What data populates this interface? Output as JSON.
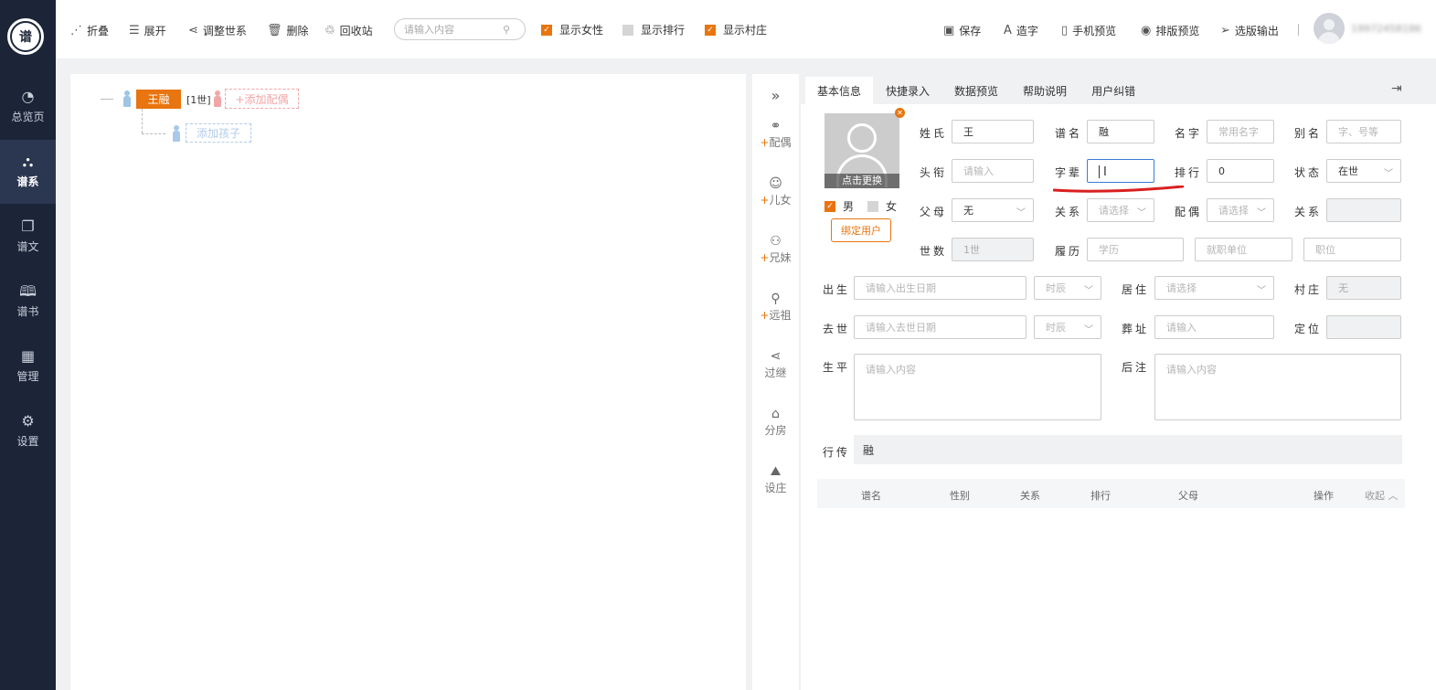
{
  "sidebar": {
    "logo": "谱",
    "items": [
      {
        "label": "总览页",
        "icon": "◔"
      },
      {
        "label": "谱系",
        "icon": "⛬"
      },
      {
        "label": "谱文",
        "icon": "❐"
      },
      {
        "label": "谱书",
        "icon": "🕮"
      },
      {
        "label": "管理",
        "icon": "▦"
      },
      {
        "label": "设置",
        "icon": "⚙"
      }
    ]
  },
  "toolbar": {
    "collapse": "折叠",
    "expand": "展开",
    "adjust": "调整世系",
    "delete": "删除",
    "recycle": "回收站",
    "search_placeholder": "请输入内容",
    "show_female": "显示女性",
    "show_rank": "显示排行",
    "show_village": "显示村庄",
    "save": "保存",
    "make_char": "造字",
    "mobile_preview": "手机预览",
    "layout_preview": "排版预览",
    "export": "选版输出",
    "username": "19972458186"
  },
  "tree": {
    "root_name": "王融",
    "root_gen": "[1世]",
    "add_spouse": "+添加配偶",
    "add_child": "添加孩子"
  },
  "actions": [
    {
      "label": "配偶",
      "plus": "+"
    },
    {
      "label": "儿女",
      "plus": "+"
    },
    {
      "label": "兄妹",
      "plus": "+"
    },
    {
      "label": "远祖",
      "plus": "+"
    },
    {
      "label": "过继",
      "plus": ""
    },
    {
      "label": "分房",
      "plus": ""
    },
    {
      "label": "设庄",
      "plus": ""
    }
  ],
  "tabs": [
    "基本信息",
    "快捷录入",
    "数据预览",
    "帮助说明",
    "用户纠错"
  ],
  "photo": {
    "caption": "点击更换"
  },
  "gender": {
    "male": "男",
    "female": "女"
  },
  "bind_user": "绑定用户",
  "form": {
    "surname_label": "姓氏",
    "surname": "王",
    "puming_label": "谱名",
    "puming": "融",
    "mingzi_label": "名字",
    "mingzi_ph": "常用名字",
    "bieming_label": "别名",
    "bieming_ph": "字、号等",
    "touxian_label": "头衔",
    "touxian_ph": "请输入",
    "zibei_label": "字辈",
    "paihang_label": "排行",
    "paihang": "0",
    "zhuangtai_label": "状态",
    "zhuangtai": "在世",
    "fumu_label": "父母",
    "fumu": "无",
    "guanxi_label": "关系",
    "guanxi_ph": "请选择",
    "peiou_label": "配偶",
    "peiou_ph": "请选择",
    "guanxi2_label": "关系",
    "shishu_label": "世数",
    "shishu": "1世",
    "lvli_label": "履历",
    "xueli_ph": "学历",
    "danwei_ph": "就职单位",
    "zhiwei_ph": "职位",
    "chusheng_label": "出生",
    "chusheng_ph": "请输入出生日期",
    "shichen_ph": "时辰",
    "juzhu_label": "居住",
    "juzhu_ph": "请选择",
    "cunzhuang_label": "村庄",
    "cunzhuang": "无",
    "qushi_label": "去世",
    "qushi_ph": "请输入去世日期",
    "shichen2_ph": "时辰",
    "zangzhi_label": "葬址",
    "zangzhi_ph": "请输入",
    "dingwei_label": "定位",
    "shengping_label": "生平",
    "shengping_ph": "请输入内容",
    "houzhu_label": "后注",
    "houzhu_ph": "请输入内容",
    "xingchuan_label": "行传",
    "xingchuan": "融"
  },
  "table": {
    "headers": [
      "谱名",
      "性别",
      "关系",
      "排行",
      "父母",
      "操作",
      "收起 ︿"
    ]
  },
  "colors": {
    "accent": "#e8750f",
    "sidebar_bg": "#1c2538",
    "sidebar_active": "#2b3650"
  }
}
